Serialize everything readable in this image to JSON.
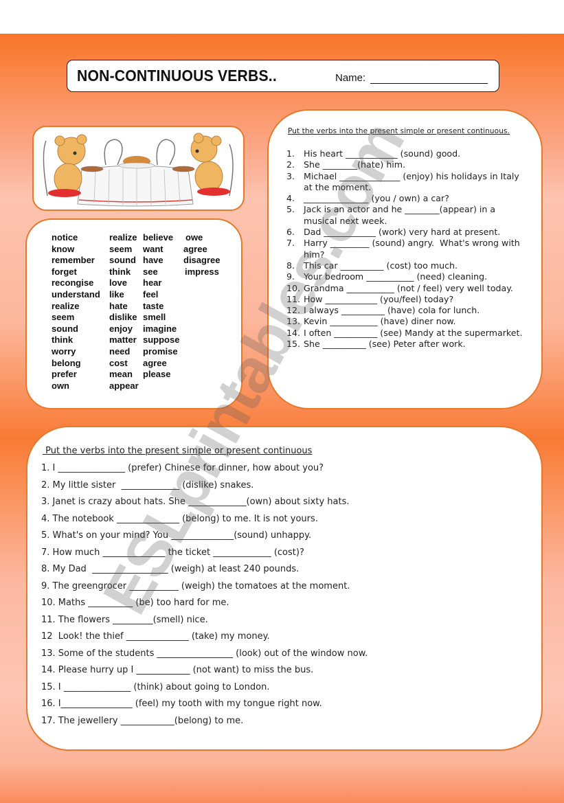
{
  "header": {
    "title": "NON-CONTINUOUS VERBS..",
    "name_label": "Name:"
  },
  "illustration": {
    "description": "Two teddy bears sitting on red chairs at a dinner table with roast chicken"
  },
  "verb_bank": {
    "columns": [
      [
        "notice",
        "know",
        "remember",
        "forget",
        "recongise",
        "understand",
        "realize",
        "seem",
        "sound",
        "think",
        "worry",
        "belong",
        "prefer",
        "own"
      ],
      [
        "realize",
        "seem",
        "sound",
        "think",
        "love",
        "like",
        "hate",
        "dislike",
        "enjoy",
        "matter",
        "need",
        "cost",
        "mean",
        "appear"
      ],
      [
        "believe",
        "want",
        "have",
        "see",
        "hear",
        "feel",
        "taste",
        "smell",
        "imagine",
        "suppose",
        "promise",
        "agree",
        "please"
      ],
      [
        "owe",
        "agree",
        "disagree",
        "impress"
      ]
    ]
  },
  "exercise1": {
    "instruction": "Put the verbs into the present simple or present continuous.",
    "items": [
      {
        "num": "1.",
        "text": "His heart ____________ (sound) good."
      },
      {
        "num": "2.",
        "text": "She ________(hate) him."
      },
      {
        "num": "3.",
        "text": "Michael ______________ (enjoy) his holidays in Italy at the moment."
      },
      {
        "num": "4.",
        "text": "_______________ (you / own) a car?"
      },
      {
        "num": "5.",
        "text": "Jack is an actor and he ________(appear) in a musical next week."
      },
      {
        "num": "6.",
        "text": "Dad ____________ (work) very hard at present."
      },
      {
        "num": "7.",
        "text": "Harry _________ (sound) angry.  What's wrong with him?"
      },
      {
        "num": "8.",
        "text": "This car __________ (cost) too much."
      },
      {
        "num": "9.",
        "text": "Your bedroom ___________ (need) cleaning."
      },
      {
        "num": "10.",
        "text": "Grandma ___________ (not / feel) very well today."
      },
      {
        "num": "11.",
        "text": "How ____________ (you/feel) today?"
      },
      {
        "num": "12.",
        "text": "I always __________ (have) cola for lunch."
      },
      {
        "num": "13.",
        "text": "Kevin ___________ (have) diner now."
      },
      {
        "num": "14.",
        "text": "I often __________ (see) Mandy at the supermarket."
      },
      {
        "num": "15.",
        "text": "She __________ (see) Peter after work."
      }
    ]
  },
  "exercise2": {
    "instruction": " Put the verbs into the present simple or present continuous",
    "items": [
      "1. I _______________ (prefer) Chinese for dinner, how about you?",
      "2. My little sister  _____________ (dislike) snakes.",
      "3. Janet is crazy about hats. She _____________(own) about sixty hats.",
      "4. The notebook ______________ (belong) to me. It is not yours.",
      "5. What's on your mind? You ______________(sound) unhappy.",
      "7. How much ______________ the ticket _____________ (cost)?",
      "8. My Dad  _________________ (weigh) at least 240 pounds.",
      "9. The greengrocer ___________ (weigh) the tomatoes at the moment.",
      "10. Maths __________ (be) too hard for me.",
      "11. The flowers _________(smell) nice.",
      "12  Look! the thief ______________ (take) my money.",
      "13. Some of the students _________________ (look) out of the window now.",
      "14. Please hurry up I ____________ (not want) to miss the bus.",
      "15. I _______________ (think) about going to London.",
      "16. I________________ (feel) my tooth with my tongue right now.",
      "17. The jewellery ____________(belong) to me."
    ]
  },
  "watermark": "ESLprintables.com",
  "colors": {
    "accent_orange": "#e8782a",
    "band_orange": "#f97628"
  }
}
